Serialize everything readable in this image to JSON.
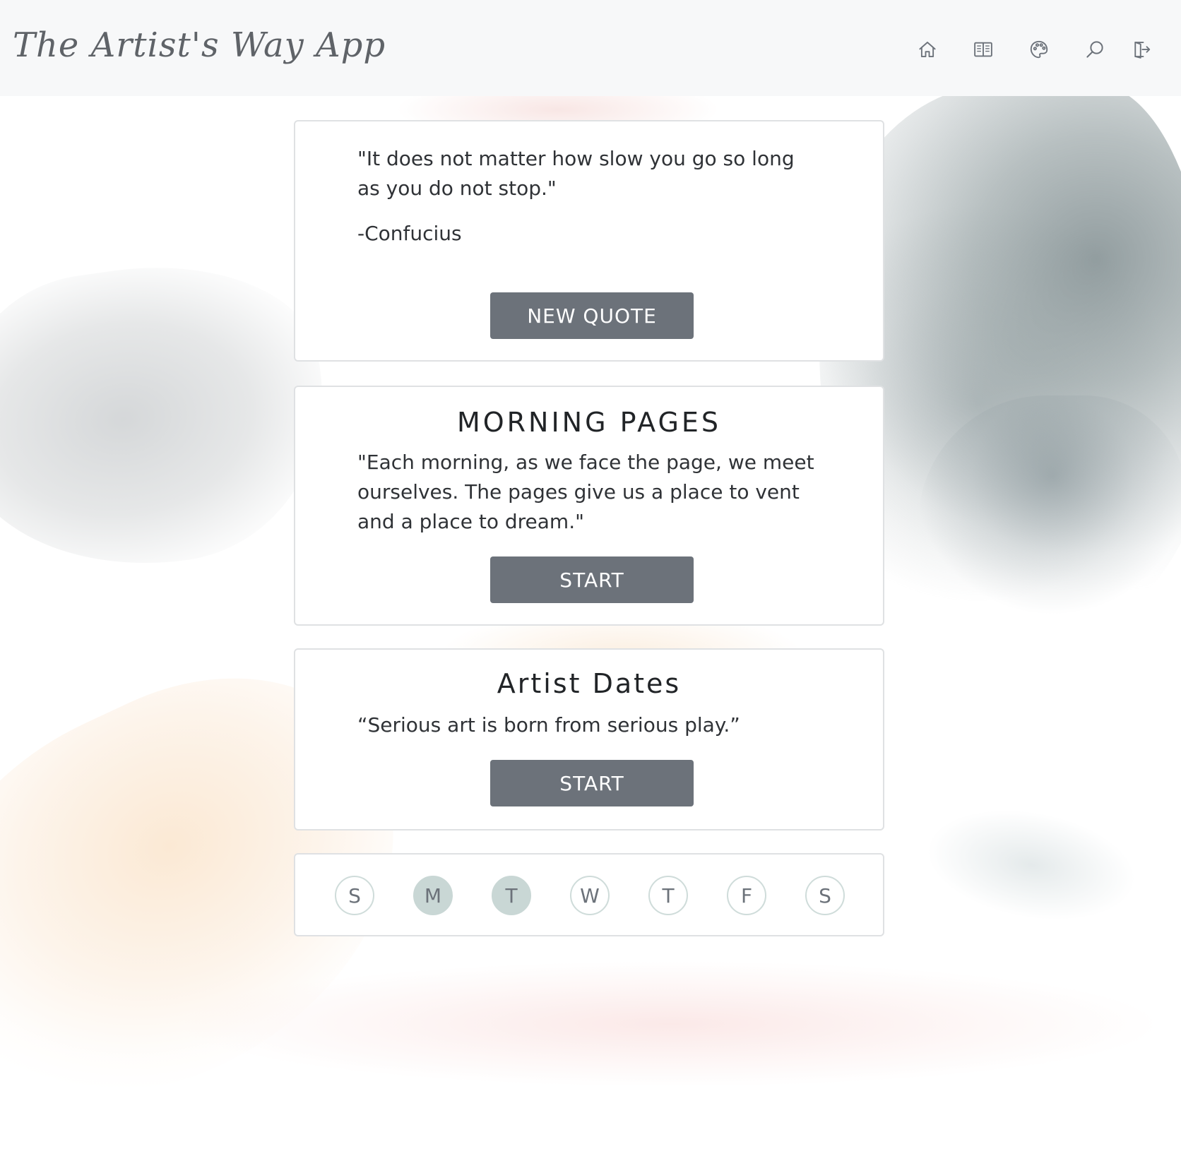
{
  "header": {
    "app_title": "The Artist's Way App",
    "nav": [
      {
        "icon": "home-icon",
        "label": "Home"
      },
      {
        "icon": "open-book-icon",
        "label": "Morning Pages"
      },
      {
        "icon": "palette-icon",
        "label": "Artist Dates"
      },
      {
        "icon": "search-icon",
        "label": "Search"
      },
      {
        "icon": "logout-icon",
        "label": "Log out"
      }
    ]
  },
  "quote_card": {
    "text": "\"It does not matter how slow you go so long as you do not stop.\"",
    "author": "-Confucius",
    "button_label": "NEW QUOTE"
  },
  "morning_pages_card": {
    "title": "MORNING PAGES",
    "quote": "\"Each morning, as we face the page, we meet ourselves. The pages give us a place to vent and a place to dream.\"",
    "button_label": "START"
  },
  "artist_dates_card": {
    "title": "Artist Dates",
    "quote": "“Serious art is born from serious play.”",
    "button_label": "START"
  },
  "week_tracker": {
    "days": [
      {
        "label": "S",
        "done": false
      },
      {
        "label": "M",
        "done": true
      },
      {
        "label": "T",
        "done": true
      },
      {
        "label": "W",
        "done": false
      },
      {
        "label": "T",
        "done": false
      },
      {
        "label": "F",
        "done": false
      },
      {
        "label": "S",
        "done": false
      }
    ]
  },
  "colors": {
    "header_bg": "#f7f8f9",
    "button_bg": "#6c727a",
    "day_done": "#c9d7d5",
    "title_gray": "#5f6368"
  }
}
